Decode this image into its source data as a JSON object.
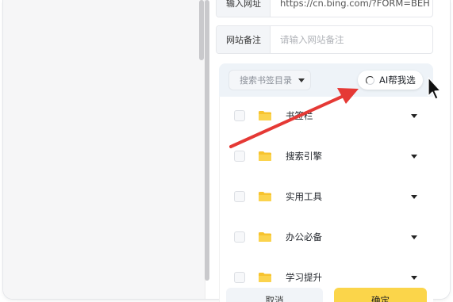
{
  "form": {
    "url_label": "输入网址",
    "url_value": "https://cn.bing.com/?FORM=BEH",
    "remark_label": "网站备注",
    "remark_placeholder": "请输入网站备注"
  },
  "picker": {
    "directory_select_placeholder": "搜索书签目录",
    "ai_button_label": "AI帮我选",
    "folders": [
      {
        "label": "书签栏"
      },
      {
        "label": "搜索引擎"
      },
      {
        "label": "实用工具"
      },
      {
        "label": "办公必备"
      },
      {
        "label": "学习提升"
      }
    ]
  },
  "footer": {
    "cancel_label": "取消",
    "confirm_label": "确定"
  },
  "colors": {
    "folder": "#f7c32e",
    "arrow": "#e53935",
    "confirm": "#fbd54a",
    "picker_bg": "#eef3f8"
  },
  "icons": [
    "folder-icon",
    "chevron-down-icon",
    "spinner-icon",
    "mouse-cursor-icon",
    "annotation-arrow"
  ]
}
